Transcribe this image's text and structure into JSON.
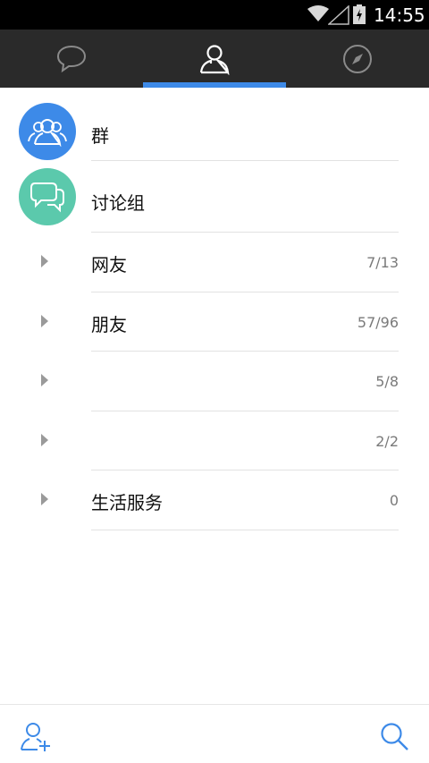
{
  "status_bar": {
    "time": "14:55"
  },
  "tabs": [
    {
      "name": "messages",
      "icon": "chat-bubble-icon"
    },
    {
      "name": "contacts",
      "icon": "person-icon",
      "active": true
    },
    {
      "name": "discover",
      "icon": "compass-icon"
    }
  ],
  "colors": {
    "accent": "#3d8ae8",
    "group_avatar": "#3d8ae8",
    "discussion_avatar": "#5bc9ac",
    "tab_bar": "#2a2a2a"
  },
  "top_items": [
    {
      "label": "群",
      "icon": "group-icon"
    },
    {
      "label": "讨论组",
      "icon": "discussion-icon"
    }
  ],
  "groups": [
    {
      "name": "网友",
      "count": "7/13"
    },
    {
      "name": "朋友",
      "count": "57/96"
    },
    {
      "name": "",
      "count": "5/8"
    },
    {
      "name": "",
      "count": "2/2"
    },
    {
      "name": "生活服务",
      "count": "0"
    }
  ],
  "bottom_bar": {
    "left_icon": "add-friend-icon",
    "right_icon": "search-icon"
  }
}
